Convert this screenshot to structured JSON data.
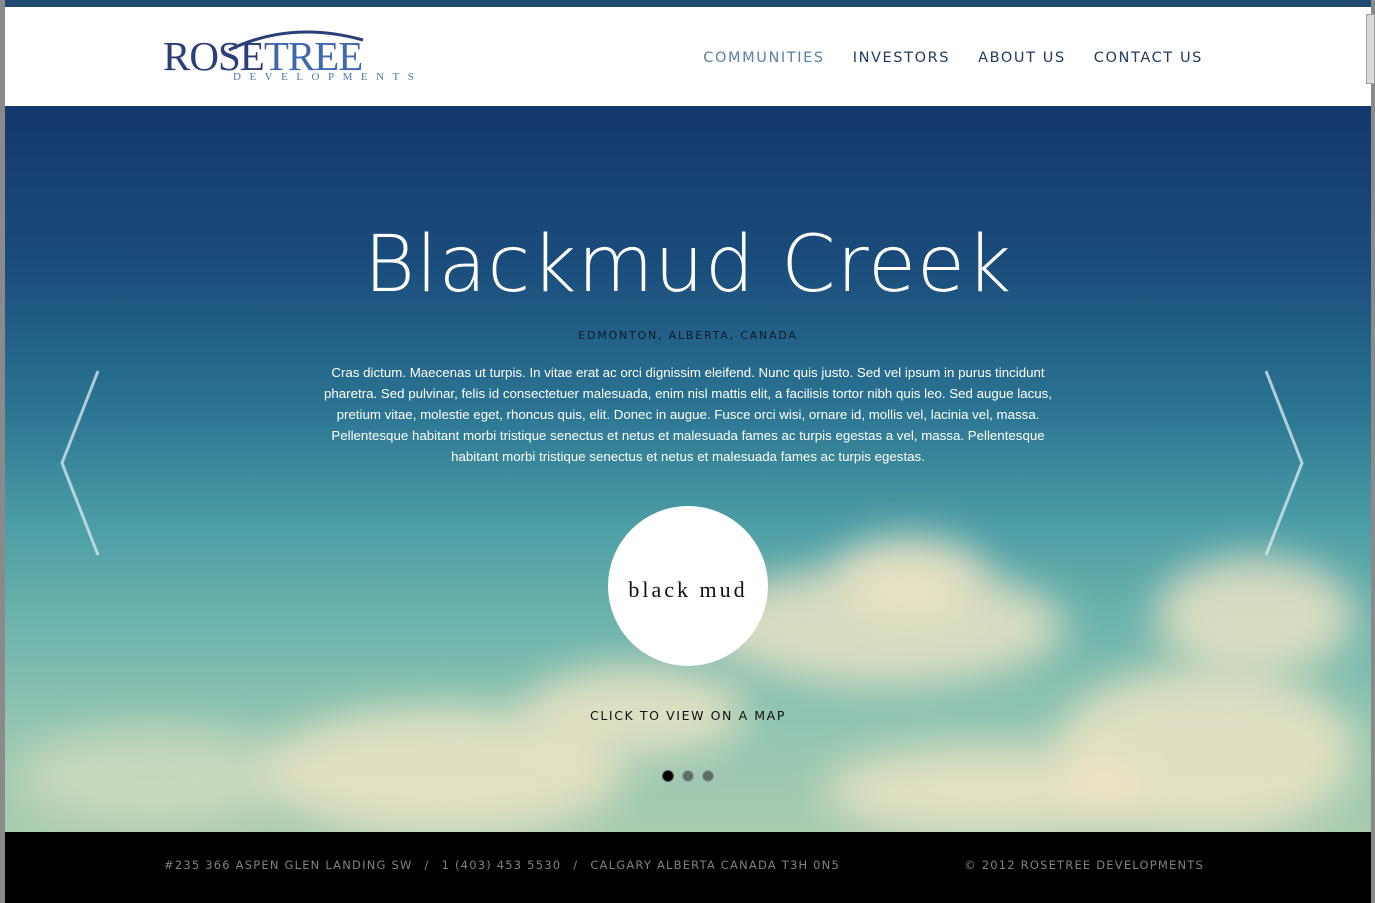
{
  "brand": {
    "name_part1": "ROSE",
    "name_part2": "TREE",
    "tagline": "DEVELOPMENTS"
  },
  "nav": {
    "items": [
      {
        "label": "COMMUNITIES",
        "active": true
      },
      {
        "label": "INVESTORS",
        "active": false
      },
      {
        "label": "ABOUT US",
        "active": false
      },
      {
        "label": "CONTACT US",
        "active": false
      }
    ]
  },
  "hero": {
    "title": "Blackmud Creek",
    "location": "EDMONTON, ALBERTA, CANADA",
    "description": "Cras dictum. Maecenas ut turpis. In vitae erat ac orci dignissim eleifend. Nunc quis justo. Sed vel ipsum in purus tincidunt pharetra. Sed pulvinar, felis id consectetuer malesuada, enim nisl mattis elit, a facilisis tortor nibh quis leo. Sed augue lacus, pretium vitae, molestie eget, rhoncus quis, elit. Donec in augue. Fusce orci wisi, ornare id, mollis vel, lacinia vel, massa. Pellentesque habitant morbi tristique senectus et netus et malesuada fames ac turpis egestas a vel, massa. Pellentesque habitant morbi tristique senectus et netus et malesuada fames ac turpis egestas.",
    "badge_text": "black mud",
    "map_link": "CLICK TO VIEW ON A MAP",
    "arrow_left_icon": "chevron-left-icon",
    "arrow_right_icon": "chevron-right-icon",
    "slides_total": 3,
    "slide_active": 1
  },
  "footer": {
    "address": "#235 366 ASPEN GLEN LANDING SW",
    "separator": "/",
    "phone": "1 (403) 453 5530",
    "city": "CALGARY ALBERTA CANADA T3H 0N5",
    "copyright": "© 2012 ROSETREE DEVELOPMENTS"
  },
  "colors": {
    "top_strip": "#1d4a6e",
    "nav_text": "#1f3b61",
    "nav_active": "#5a80a3",
    "logo_dark": "#2a3f7a",
    "logo_light": "#3e68b0",
    "footer_bg": "#000000",
    "footer_text": "#7d8289"
  }
}
